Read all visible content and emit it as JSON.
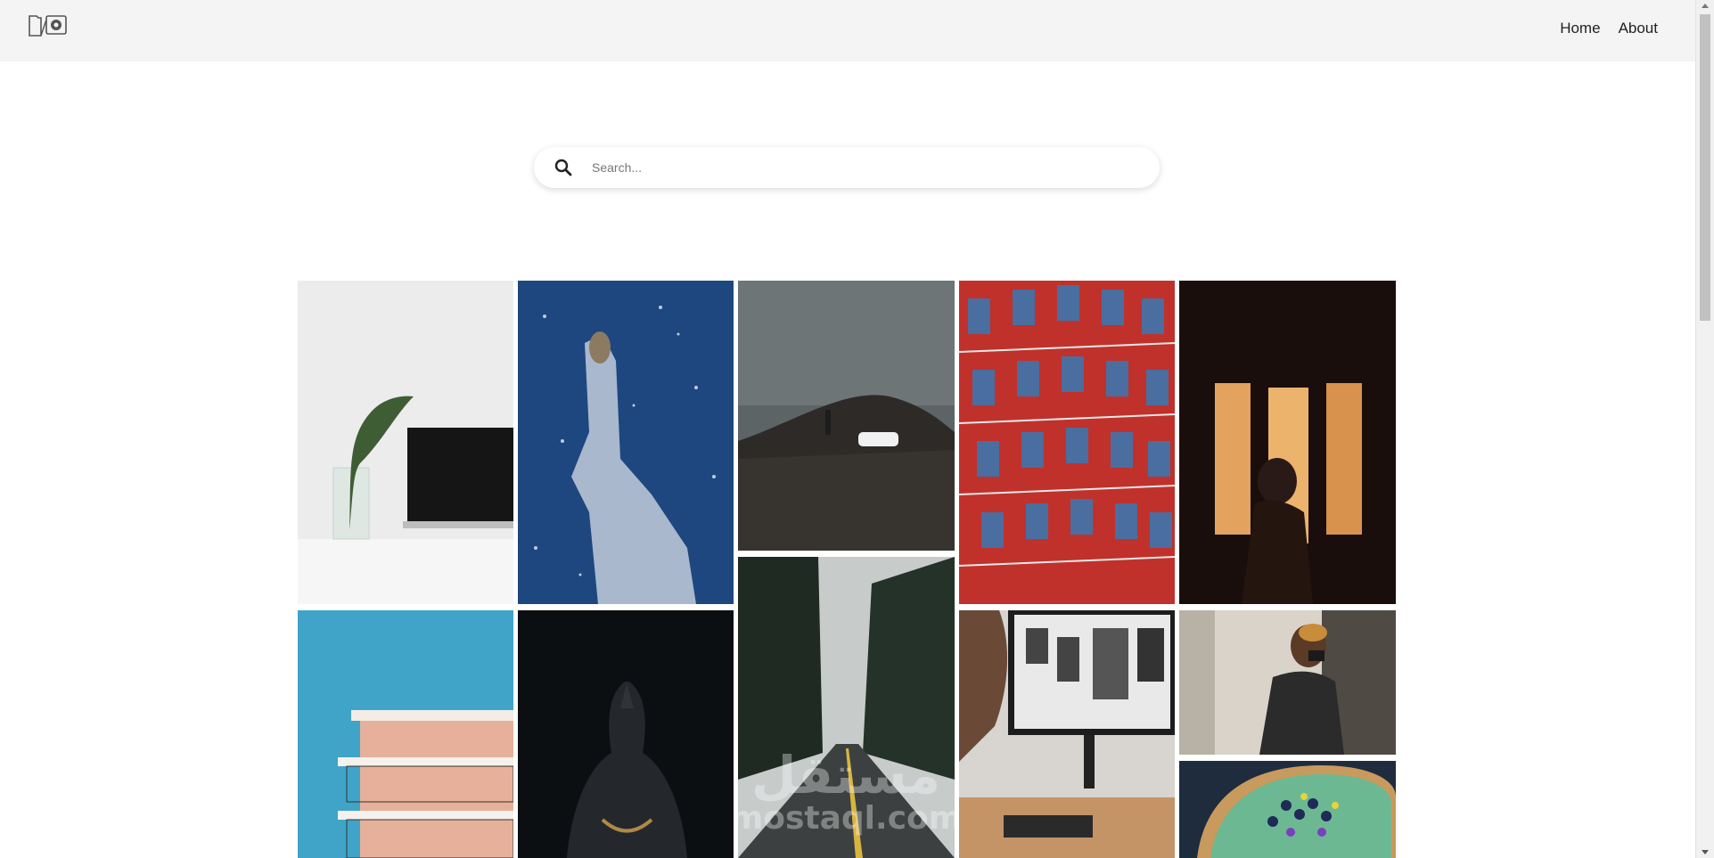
{
  "brand": {
    "logo_icon": "camera-folder-logo-icon"
  },
  "nav": {
    "items": [
      {
        "label": "Home"
      },
      {
        "label": "About"
      }
    ]
  },
  "search": {
    "placeholder": "Search...",
    "value": "",
    "icon": "search-icon"
  },
  "gallery": {
    "images": [
      {
        "name": "photo-plant-laptop",
        "subject": "plant in glass beside laptop"
      },
      {
        "name": "photo-owl-snow",
        "subject": "owl on icy rock in snowfall"
      },
      {
        "name": "photo-car-hill",
        "subject": "person and white car on dark hill"
      },
      {
        "name": "photo-red-building",
        "subject": "red and blue glass building facade"
      },
      {
        "name": "photo-window-silhouette",
        "subject": "silhouette by glowing window"
      },
      {
        "name": "photo-pink-building",
        "subject": "pink building balconies against blue sky"
      },
      {
        "name": "photo-buddha-statue",
        "subject": "dark buddha statue"
      },
      {
        "name": "photo-forest-road",
        "subject": "road through misty forest"
      },
      {
        "name": "photo-designer-monitor",
        "subject": "man at monitor with phone designs"
      },
      {
        "name": "photo-masked-man-door",
        "subject": "masked man opening door"
      },
      {
        "name": "photo-berry-tart",
        "subject": "green tart with berries and flowers"
      }
    ],
    "watermark": {
      "arabic": "مستقل",
      "latin": "mostaql.com"
    }
  },
  "colors": {
    "navbar_bg": "#f4f4f4",
    "page_bg": "#ffffff",
    "text": "#222222"
  }
}
